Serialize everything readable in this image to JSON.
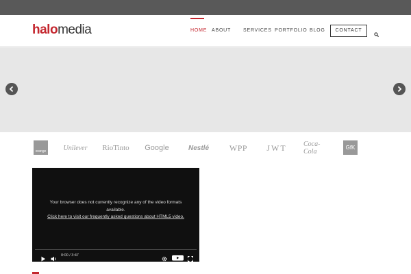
{
  "header": {
    "logo_part1": "halo",
    "logo_part2": "media"
  },
  "nav": {
    "items": [
      {
        "label": "HOME",
        "active": true
      },
      {
        "label": "ABOUT",
        "active": false
      },
      {
        "label": "SERVICES",
        "active": false
      },
      {
        "label": "PORTFOLIO",
        "active": false
      },
      {
        "label": "BLOG",
        "active": false
      }
    ],
    "contact_label": "CONTACT",
    "search_icon": "search-icon"
  },
  "slider": {
    "prev_icon": "chevron-left-icon",
    "next_icon": "chevron-right-icon"
  },
  "clients": {
    "orange": "orange",
    "unilever": "Unilever",
    "riotinto": "RioTinto",
    "google": "Google",
    "nestle": "Nestlé",
    "wpp": "WPP",
    "jwt": "JWT",
    "cocacola": "Coca-Cola",
    "gfk": "GfK"
  },
  "video": {
    "message": "Your browser does not currently recognize any of the video formats available.",
    "link_text": "Click here to visit our frequently asked questions about HTML5 video.",
    "time": "0:00 / 3:47",
    "youtube_label": "YouTube"
  },
  "colors": {
    "accent": "#c4262e",
    "topbar": "#595959",
    "slider_bg": "#e7e7e7",
    "video_bg": "#101010"
  }
}
